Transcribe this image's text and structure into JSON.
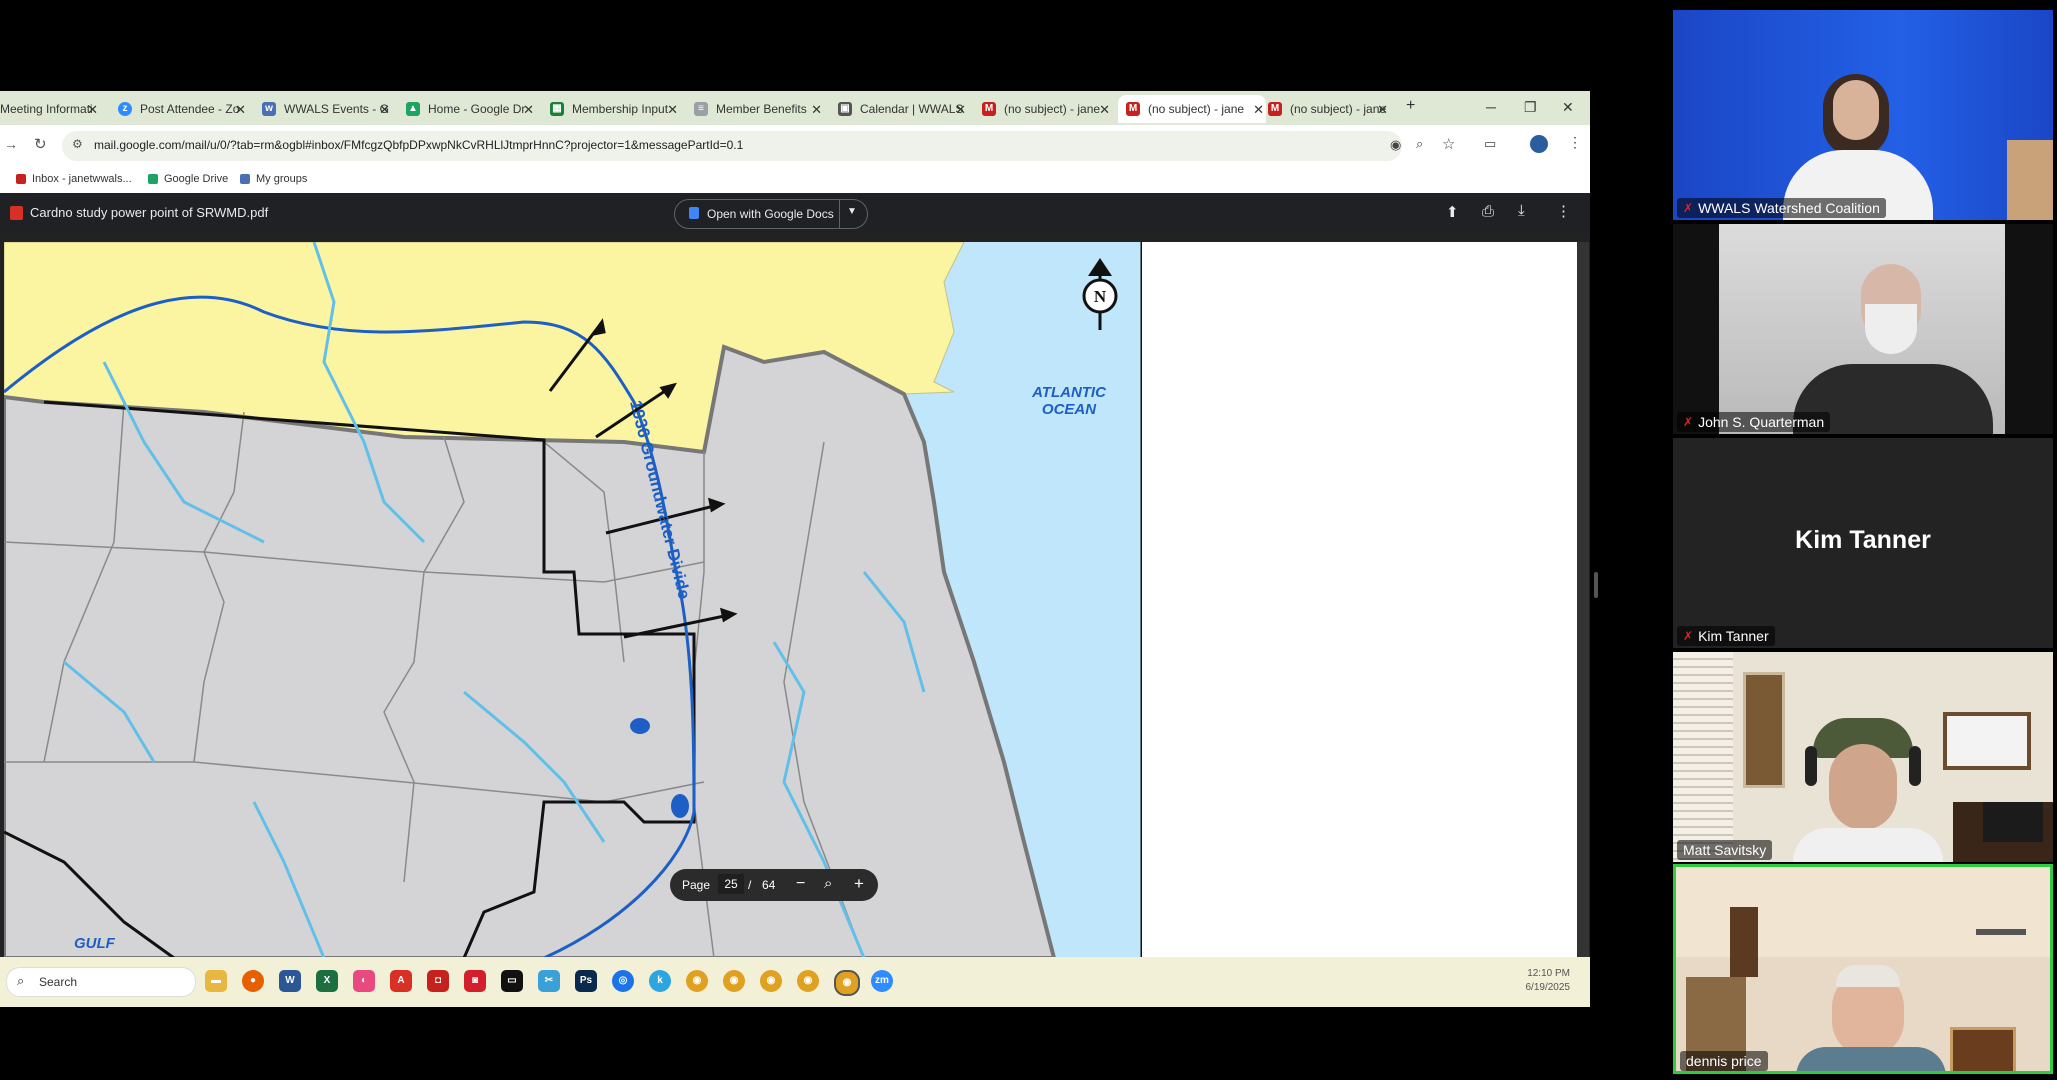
{
  "browser": {
    "tabs": [
      {
        "label": "Meeting Informati",
        "icon": "doc-icon",
        "color": "#4f6a4a"
      },
      {
        "label": "Post Attendee - Zo",
        "icon": "zoom-icon",
        "color": "#2d8cff"
      },
      {
        "label": "WWALS Events - G",
        "icon": "wwals-icon",
        "color": "#4a6fb5"
      },
      {
        "label": "Home - Google Dr",
        "icon": "drive-icon",
        "color": "#1ea362"
      },
      {
        "label": "Membership Input",
        "icon": "sheets-icon",
        "color": "#188038"
      },
      {
        "label": "Member Benefits",
        "icon": "doc-icon",
        "color": "#9aa0a6"
      },
      {
        "label": "Calendar | WWALS",
        "icon": "calendar-icon",
        "color": "#555"
      },
      {
        "label": "(no subject) - jane",
        "icon": "gmail-icon",
        "color": "#c5221f"
      },
      {
        "label": "(no subject) - jane",
        "icon": "gmail-icon",
        "color": "#c5221f"
      },
      {
        "label": "(no subject) - jane",
        "icon": "gmail-icon",
        "color": "#c5221f"
      }
    ],
    "new_tab": "+",
    "url": "mail.google.com/mail/u/0/?tab=rm&ogbl#inbox/FMfcgzQbfpDPxwpNkCvRHLlJtmprHnnC?projector=1&messagePartId=0.1",
    "bookmarks": [
      "Inbox - janetwwals...",
      "Google Drive",
      "My groups"
    ]
  },
  "pdf": {
    "filename": "Cardno study power point of SRWMD.pdf",
    "open_with": "Open with Google Docs",
    "page_label": "Page",
    "page_current": "25",
    "page_sep": "/",
    "page_total": "64"
  },
  "map": {
    "ocean_label_1": "ATLANTIC",
    "ocean_label_2": "OCEAN",
    "divide_label": "1936 Groundwater Divide",
    "gulf_label": "GULF",
    "north_label": "N"
  },
  "taskbar": {
    "search_placeholder": "Search",
    "time": "12:10 PM",
    "date": "6/19/2025"
  },
  "participants": [
    {
      "name": "WWALS Watershed Coalition",
      "muted": true
    },
    {
      "name": "John S. Quarterman",
      "muted": true
    },
    {
      "name": "Kim Tanner",
      "muted": true,
      "display": "Kim Tanner"
    },
    {
      "name": "Matt Savitsky",
      "muted": false
    },
    {
      "name": "dennis price",
      "muted": false
    }
  ],
  "colors": {
    "active_speaker": "#2ecc40",
    "map_yellow": "#fbf5a2",
    "map_gray": "#d4d4d6",
    "map_water": "#bfe6fa",
    "river": "#62c0e8"
  }
}
